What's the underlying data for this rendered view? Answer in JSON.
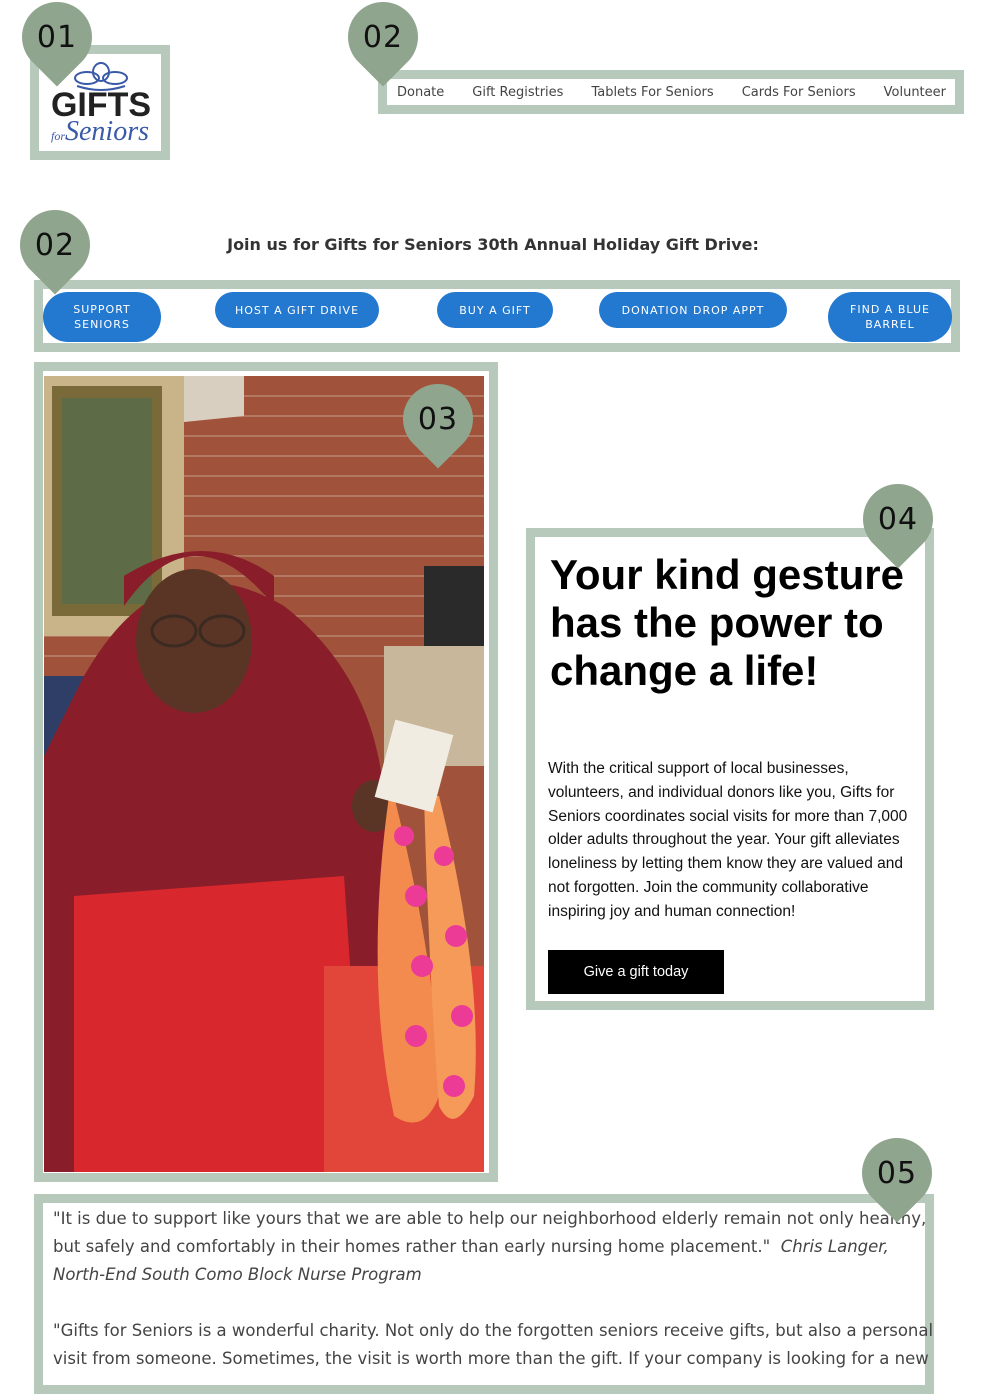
{
  "logo": {
    "line1": "GIFTS",
    "line2a": "for",
    "line2b": "Seniors"
  },
  "markers": {
    "logo": "01",
    "nav": "02",
    "cta": "02",
    "photo": "03",
    "card": "04",
    "quotes": "05"
  },
  "nav": {
    "items": [
      "Donate",
      "Gift Registries",
      "Tablets For Seniors",
      "Cards For Seniors",
      "Volunteer"
    ]
  },
  "drive": {
    "title": "Join us for Gifts for Seniors 30th Annual Holiday Gift Drive:"
  },
  "cta": {
    "support": [
      "SUPPORT",
      "SENIORS"
    ],
    "host": "HOST A GIFT DRIVE",
    "buy": "BUY A GIFT",
    "dropoff": "DONATION DROP APPT",
    "barrel": [
      "FIND A BLUE",
      "BARREL"
    ]
  },
  "card": {
    "headline": "Your kind gesture has the power to change a life!",
    "body": "With the critical support of local businesses, volunteers, and individual donors like you, Gifts for Seniors coordinates social visits for more than 7,000 older adults throughout the year.  Your gift alleviates loneliness by letting them know they are valued and not forgotten.  Join the community collaborative inspiring joy and human connection!",
    "button": "Give a gift today"
  },
  "quotes": {
    "q1_text": "\"It is due to support like yours that we are able to help our neighborhood elderly remain not only healthy, but safely and comfortably in their homes rather than early nursing home placement.\"",
    "q1_author": "Chris Langer, North-End South Como Block Nurse Program",
    "q2_text": "\"Gifts for Seniors is a wonderful charity.  Not only do the forgotten seniors receive gifts, but also a personal visit from someone.  Sometimes, the visit is worth more than the gift.  If your company is looking for a new"
  },
  "colors": {
    "frame": "#b7c9bb",
    "marker": "#8fa58e",
    "pill": "#2378d0",
    "button": "#000000"
  }
}
